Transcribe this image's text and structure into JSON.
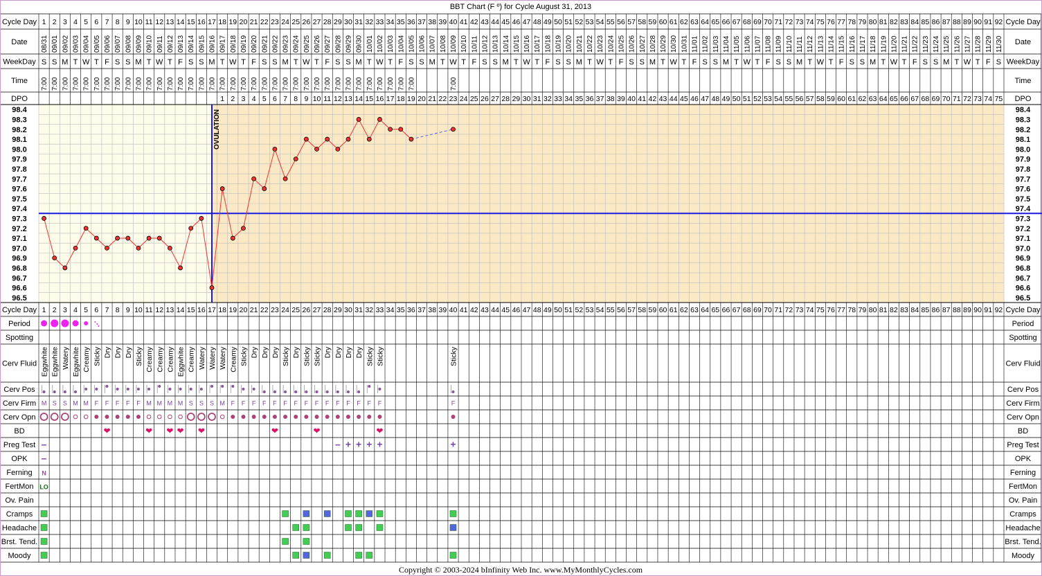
{
  "title": "BBT Chart (F º) for Cycle August 31, 2013",
  "copyright": "Copyright © 2003-2024 bInfinity Web Inc.     www.MyMonthlyCycles.com",
  "row_labels": {
    "cycle_day": "Cycle Day",
    "date": "Date",
    "weekday": "WeekDay",
    "time": "Time",
    "dpo": "DPO",
    "period": "Period",
    "spotting": "Spotting",
    "cerv_fluid": "Cerv Fluid",
    "cerv_pos": "Cerv Pos",
    "cerv_firm": "Cerv Firm",
    "cerv_opn": "Cerv Opn",
    "bd": "BD",
    "preg_test": "Preg Test",
    "opk": "OPK",
    "ferning": "Ferning",
    "fertmon": "FertMon",
    "ov_pain": "Ov. Pain",
    "cramps": "Cramps",
    "headache": "Headache",
    "brst_tend": "Brst. Tend.",
    "moody": "Moody"
  },
  "ovulation_label": "OVULATION",
  "colors": {
    "pre_ovulation_bg": "#fdfbea",
    "post_ovulation_bg": "#fbe9c6",
    "temp_line": "#ee3333",
    "coverline": "#1a1adf",
    "ovulation_line": "#1a1adf",
    "period": "#ee22ee",
    "heart": "#dd1166",
    "preg_test": "#7744aa",
    "symptom_green": "#44cc55",
    "symptom_blue": "#5566dd",
    "border": "#cc99cc"
  },
  "days": 92,
  "dates": [
    "08/31",
    "09/01",
    "09/02",
    "09/03",
    "09/04",
    "09/05",
    "09/06",
    "09/07",
    "09/08",
    "09/09",
    "09/10",
    "09/11",
    "09/12",
    "09/13",
    "09/14",
    "09/15",
    "09/16",
    "09/17",
    "09/18",
    "09/19",
    "09/20",
    "09/21",
    "09/22",
    "09/23",
    "09/24",
    "09/25",
    "09/26",
    "09/27",
    "09/28",
    "09/29",
    "09/30",
    "10/01",
    "10/02",
    "10/03",
    "10/04",
    "10/05",
    "10/06",
    "10/07",
    "10/08",
    "10/09",
    "10/10",
    "10/11",
    "10/12",
    "10/13",
    "10/14",
    "10/15",
    "10/16",
    "10/17",
    "10/18",
    "10/19",
    "10/20",
    "10/21",
    "10/22",
    "10/23",
    "10/24",
    "10/25",
    "10/26",
    "10/27",
    "10/28",
    "10/29",
    "10/30",
    "10/31",
    "11/01",
    "11/02",
    "11/03",
    "11/04",
    "11/05",
    "11/06",
    "11/07",
    "11/08",
    "11/09",
    "11/10",
    "11/11",
    "11/12",
    "11/13",
    "11/14",
    "11/15",
    "11/16",
    "11/17",
    "11/18",
    "11/19",
    "11/20",
    "11/21",
    "11/22",
    "11/23",
    "11/24",
    "11/25",
    "11/26",
    "11/27",
    "11/28",
    "11/29",
    "11/30"
  ],
  "weekdays": [
    "S",
    "S",
    "M",
    "T",
    "W",
    "T",
    "F",
    "S",
    "S",
    "M",
    "T",
    "W",
    "T",
    "F",
    "S",
    "S",
    "M",
    "T",
    "W",
    "T",
    "F",
    "S",
    "S",
    "M",
    "T",
    "W",
    "T",
    "F",
    "S",
    "S",
    "M",
    "T",
    "W",
    "T",
    "F",
    "S",
    "S",
    "M",
    "T",
    "W",
    "T",
    "F",
    "S",
    "S",
    "M",
    "T",
    "W",
    "T",
    "F",
    "S",
    "S",
    "M",
    "T",
    "W",
    "T",
    "F",
    "S",
    "S",
    "M",
    "T",
    "W",
    "T",
    "F",
    "S",
    "S",
    "M",
    "T",
    "W",
    "T",
    "F",
    "S",
    "S",
    "M",
    "T",
    "W",
    "T",
    "F",
    "S",
    "S",
    "M",
    "T",
    "W",
    "T",
    "F",
    "S",
    "S",
    "M",
    "T",
    "W",
    "T",
    "F",
    "S"
  ],
  "times": [
    "7:00",
    "7:00",
    "7:00",
    "7:00",
    "7:00",
    "7:00",
    "7:00",
    "7:00",
    "7:00",
    "7:00",
    "7:00",
    "7:00",
    "7:00",
    "7:00",
    "7:00",
    "7:00",
    "7:00",
    "7:00",
    "7:00",
    "7:00",
    "7:00",
    "7:00",
    "7:00",
    "7:00",
    "7:00",
    "7:00",
    "7:00",
    "7:00",
    "7:00",
    "7:00",
    "7:00",
    "7:00",
    "7:00",
    "7:00",
    "7:00",
    "7:00",
    "",
    "",
    "",
    "7:00"
  ],
  "ovulation_day": 17,
  "cerv_fluid": [
    "Eggwhite",
    "Eggwhite",
    "Watery",
    "Eggwhite",
    "Creamy",
    "Sticky",
    "Dry",
    "Dry",
    "Dry",
    "Sticky",
    "Creamy",
    "Creamy",
    "Creamy",
    "Eggwhite",
    "Creamy",
    "Watery",
    "Watery",
    "Watery",
    "Creamy",
    "Sticky",
    "Dry",
    "Dry",
    "Dry",
    "Sticky",
    "Dry",
    "Sticky",
    "Sticky",
    "Dry",
    "Dry",
    "Dry",
    "Dry",
    "Sticky",
    "Sticky",
    "",
    "",
    "",
    "",
    "",
    "",
    "Sticky"
  ],
  "cerv_pos": [
    "low",
    "low",
    "low",
    "low",
    "mid",
    "mid",
    "high",
    "mid",
    "mid",
    "mid",
    "mid",
    "high",
    "mid",
    "mid",
    "mid",
    "mid",
    "high",
    "high",
    "high",
    "mid",
    "mid",
    "low",
    "low",
    "low",
    "low",
    "low",
    "low",
    "low",
    "low",
    "low",
    "low",
    "high",
    "mid",
    "",
    "",
    "",
    "",
    "",
    "",
    "low"
  ],
  "cerv_firm": [
    "M",
    "S",
    "S",
    "M",
    "M",
    "F",
    "F",
    "F",
    "F",
    "F",
    "M",
    "M",
    "M",
    "M",
    "S",
    "S",
    "S",
    "M",
    "F",
    "F",
    "F",
    "F",
    "F",
    "F",
    "F",
    "F",
    "F",
    "F",
    "F",
    "F",
    "F",
    "F",
    "F",
    "",
    "",
    "",
    "",
    "",
    "",
    "F"
  ],
  "cerv_opn": [
    "L",
    "L",
    "L",
    "s",
    "s",
    "m",
    "m",
    "m",
    "m",
    "m",
    "s",
    "s",
    "s",
    "s",
    "L",
    "L",
    "L",
    "s",
    "m",
    "m",
    "m",
    "m",
    "m",
    "m",
    "m",
    "m",
    "m",
    "m",
    "m",
    "m",
    "m",
    "m",
    "m",
    "",
    "",
    "",
    "",
    "",
    "",
    "m"
  ],
  "period": [
    2,
    3,
    3,
    2,
    1,
    0.5
  ],
  "bd_days": [
    7,
    11,
    13,
    14,
    16,
    23,
    27,
    33
  ],
  "preg_test": {
    "1": "–",
    "29": "–",
    "30": "+",
    "31": "+",
    "32": "+",
    "33": "+",
    "40": "+"
  },
  "opk": {
    "1": "–"
  },
  "ferning": {
    "1": "N"
  },
  "fertmon": {
    "1": "LO"
  },
  "cramps": {
    "1": "g",
    "24": "g",
    "26": "b",
    "28": "b",
    "30": "g",
    "31": "g",
    "32": "b",
    "33": "g",
    "40": "g"
  },
  "headache": {
    "1": "g",
    "25": "g",
    "26": "g",
    "30": "g",
    "31": "g",
    "33": "g",
    "40": "b"
  },
  "brst_tend": {
    "1": "g",
    "24": "g",
    "26": "g"
  },
  "moody": {
    "1": "g",
    "25": "g",
    "26": "b",
    "28": "g",
    "31": "g",
    "32": "g",
    "40": "g"
  },
  "chart_data": {
    "type": "line",
    "title": "BBT Chart (F º) for Cycle August 31, 2013",
    "y_ticks": [
      "98.4",
      "98.3",
      "98.2",
      "98.1",
      "98.0",
      "97.9",
      "97.8",
      "97.7",
      "97.6",
      "97.5",
      "97.4",
      "97.3",
      "97.2",
      "97.1",
      "97.0",
      "96.9",
      "96.8",
      "96.7",
      "96.6",
      "96.5"
    ],
    "ylim": [
      96.5,
      98.4
    ],
    "x": [
      1,
      2,
      3,
      4,
      5,
      6,
      7,
      8,
      9,
      10,
      11,
      12,
      13,
      14,
      15,
      16,
      17,
      18,
      19,
      20,
      21,
      22,
      23,
      24,
      25,
      26,
      27,
      28,
      29,
      30,
      31,
      32,
      33,
      34,
      35,
      36,
      40
    ],
    "temps": [
      97.3,
      96.9,
      96.8,
      97.0,
      97.2,
      97.1,
      97.0,
      97.1,
      97.1,
      97.0,
      97.1,
      97.1,
      97.0,
      96.8,
      97.2,
      97.3,
      96.6,
      97.6,
      97.1,
      97.2,
      97.7,
      97.6,
      98.0,
      97.7,
      97.9,
      98.1,
      98.0,
      98.1,
      98.0,
      98.1,
      98.3,
      98.1,
      98.3,
      98.2,
      98.2,
      98.1,
      98.2
    ],
    "coverline": 97.4,
    "grid": true
  }
}
